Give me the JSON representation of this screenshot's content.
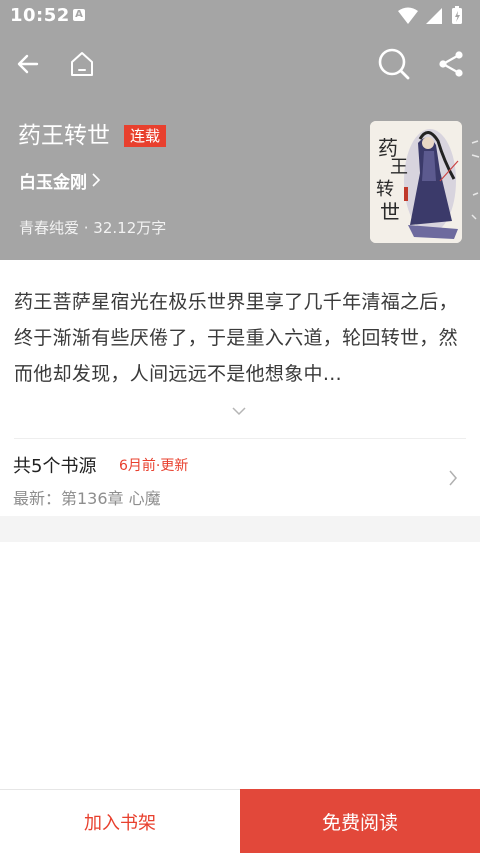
{
  "status_bar": {
    "time": "10:52",
    "notification_glyph": "A"
  },
  "book": {
    "title": "药王转世",
    "status_badge": "连载",
    "author": "白玉金刚",
    "meta": "青春纯爱 · 32.12万字",
    "cover_lettering": "药王转世"
  },
  "synopsis": "药王菩萨星宿光在极乐世界里享了几千年清福之后，终于渐渐有些厌倦了，于是重入六道，轮回转世，然而他却发现，人间远远不是他想象中…",
  "sources": {
    "title": "共5个书源",
    "update": "6月前·更新",
    "latest": "最新：第136章 心魔"
  },
  "actions": {
    "add_to_shelf": "加入书架",
    "read_free": "免费阅读"
  },
  "colors": {
    "header_bg": "#a5a5a5",
    "accent": "#e8402e"
  },
  "icons": {
    "back": "back-arrow-icon",
    "home": "home-icon",
    "search": "search-icon",
    "share": "share-icon"
  }
}
